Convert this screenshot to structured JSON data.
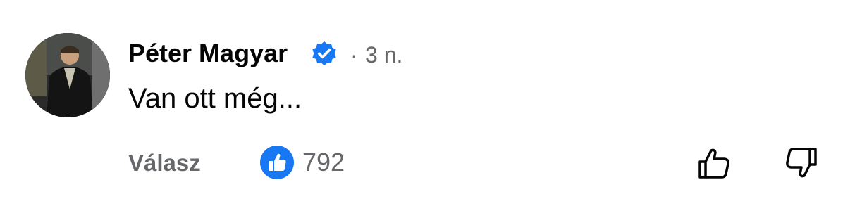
{
  "comment": {
    "author": "Péter Magyar",
    "verified": true,
    "separator": "·",
    "time": "3 n.",
    "text": "Van ott még...",
    "reply_label": "Válasz",
    "like_count": "792",
    "accent_color": "#1877f2"
  },
  "icons": {
    "verified": "verified-badge-icon",
    "like_badge": "like-reaction-icon",
    "thumb_up": "thumbs-up-outline-icon",
    "thumb_down": "thumbs-down-outline-icon"
  }
}
